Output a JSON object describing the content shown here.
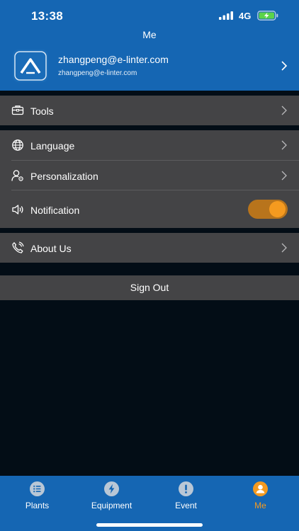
{
  "status_bar": {
    "time": "13:38",
    "network": "4G"
  },
  "header": {
    "title": "Me"
  },
  "profile": {
    "email": "zhangpeng@e-linter.com",
    "email_sub": "zhangpeng@e-linter.com"
  },
  "menu": {
    "tools": {
      "label": "Tools",
      "icon": "toolbox-icon"
    },
    "language": {
      "label": "Language",
      "icon": "globe-icon"
    },
    "personalization": {
      "label": "Personalization",
      "icon": "user-settings-icon"
    },
    "notification": {
      "label": "Notification",
      "icon": "speaker-icon",
      "enabled": true
    },
    "about": {
      "label": "About Us",
      "icon": "phone-icon"
    }
  },
  "sign_out": "Sign Out",
  "tabs": [
    {
      "label": "Plants",
      "icon": "list-icon",
      "active": false
    },
    {
      "label": "Equipment",
      "icon": "bolt-icon",
      "active": false
    },
    {
      "label": "Event",
      "icon": "alert-icon",
      "active": false
    },
    {
      "label": "Me",
      "icon": "person-icon",
      "active": true
    }
  ],
  "colors": {
    "primary": "#1566b3",
    "background": "#030d16",
    "card": "#444446",
    "accent": "#f59a1f",
    "icon_inactive": "#b9c7d6"
  }
}
